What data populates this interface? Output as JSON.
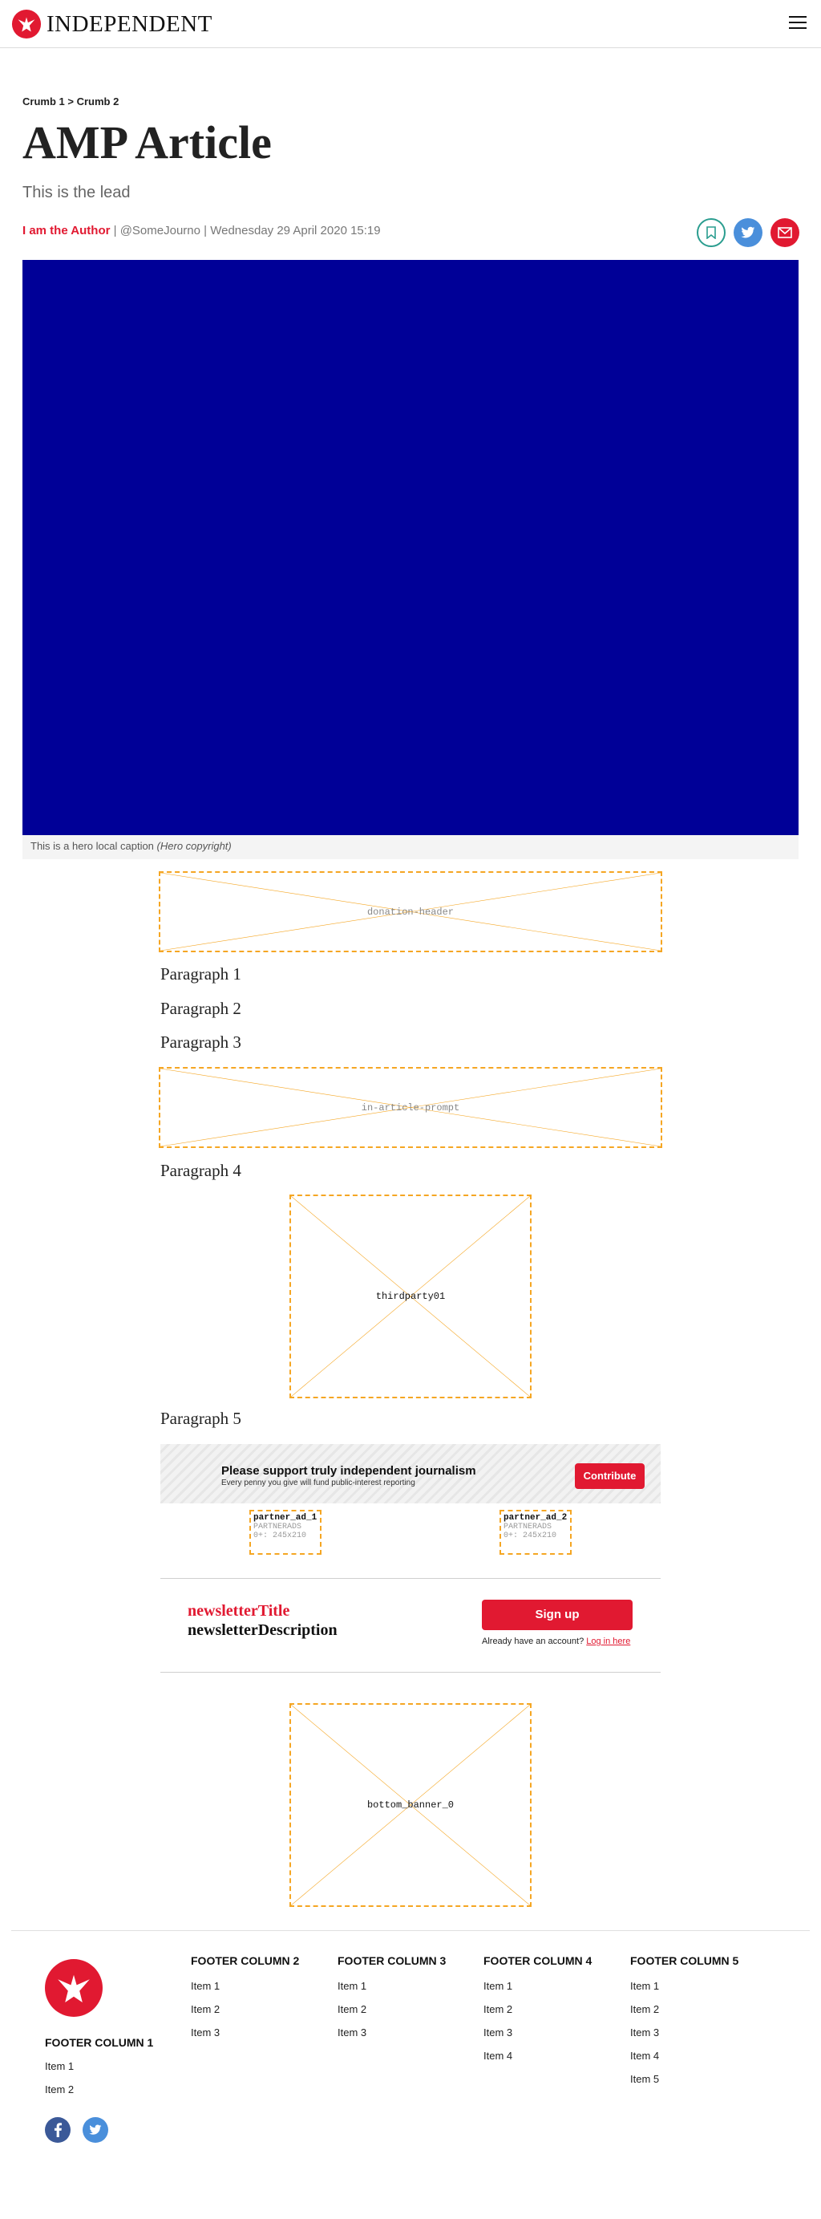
{
  "header": {
    "logo_text": "INDEPENDENT",
    "brand_color": "#e11931"
  },
  "breadcrumb": {
    "items": [
      "Crumb 1",
      "Crumb 2"
    ],
    "separator": ">"
  },
  "article": {
    "title": "AMP Article",
    "lead": "This is the lead",
    "author": "I am the Author",
    "twitter_handle": "@SomeJourno",
    "date": "Wednesday 29 April 2020 15:19",
    "hero_color": "#000097",
    "hero_caption": "This is a hero local caption",
    "hero_copyright": "(Hero copyright)",
    "paragraphs": [
      "Paragraph 1",
      "Paragraph 2",
      "Paragraph 3",
      "Paragraph 4",
      "Paragraph 5"
    ]
  },
  "placeholders": {
    "donation_header": "donation-header",
    "in_article_prompt": "in-article-prompt",
    "thirdparty": "thirdparty01",
    "bottom_banner": "bottom_banner_0"
  },
  "contribute": {
    "title": "Please support truly independent journalism",
    "subtitle": "Every penny you give will fund public-interest reporting",
    "button": "Contribute"
  },
  "partners": [
    {
      "name": "partner_ad_1",
      "provider": "PARTNERADS",
      "size": "0+: 245x210"
    },
    {
      "name": "partner_ad_2",
      "provider": "PARTNERADS",
      "size": "0+: 245x210"
    }
  ],
  "newsletter": {
    "title": "newsletterTitle",
    "description": "newsletterDescription",
    "button": "Sign up",
    "login_prompt": "Already have an account?",
    "login_link": "Log in here"
  },
  "footer": {
    "columns": [
      {
        "title": "FOOTER COLUMN 1",
        "items": [
          "Item 1",
          "Item 2"
        ]
      },
      {
        "title": "FOOTER COLUMN 2",
        "items": [
          "Item 1",
          "Item 2",
          "Item 3"
        ]
      },
      {
        "title": "FOOTER COLUMN 3",
        "items": [
          "Item 1",
          "Item 2",
          "Item 3"
        ]
      },
      {
        "title": "FOOTER COLUMN 4",
        "items": [
          "Item 1",
          "Item 2",
          "Item 3",
          "Item 4"
        ]
      },
      {
        "title": "FOOTER COLUMN 5",
        "items": [
          "Item 1",
          "Item 2",
          "Item 3",
          "Item 4",
          "Item 5"
        ]
      }
    ],
    "social": [
      "facebook-icon",
      "twitter-icon"
    ]
  }
}
